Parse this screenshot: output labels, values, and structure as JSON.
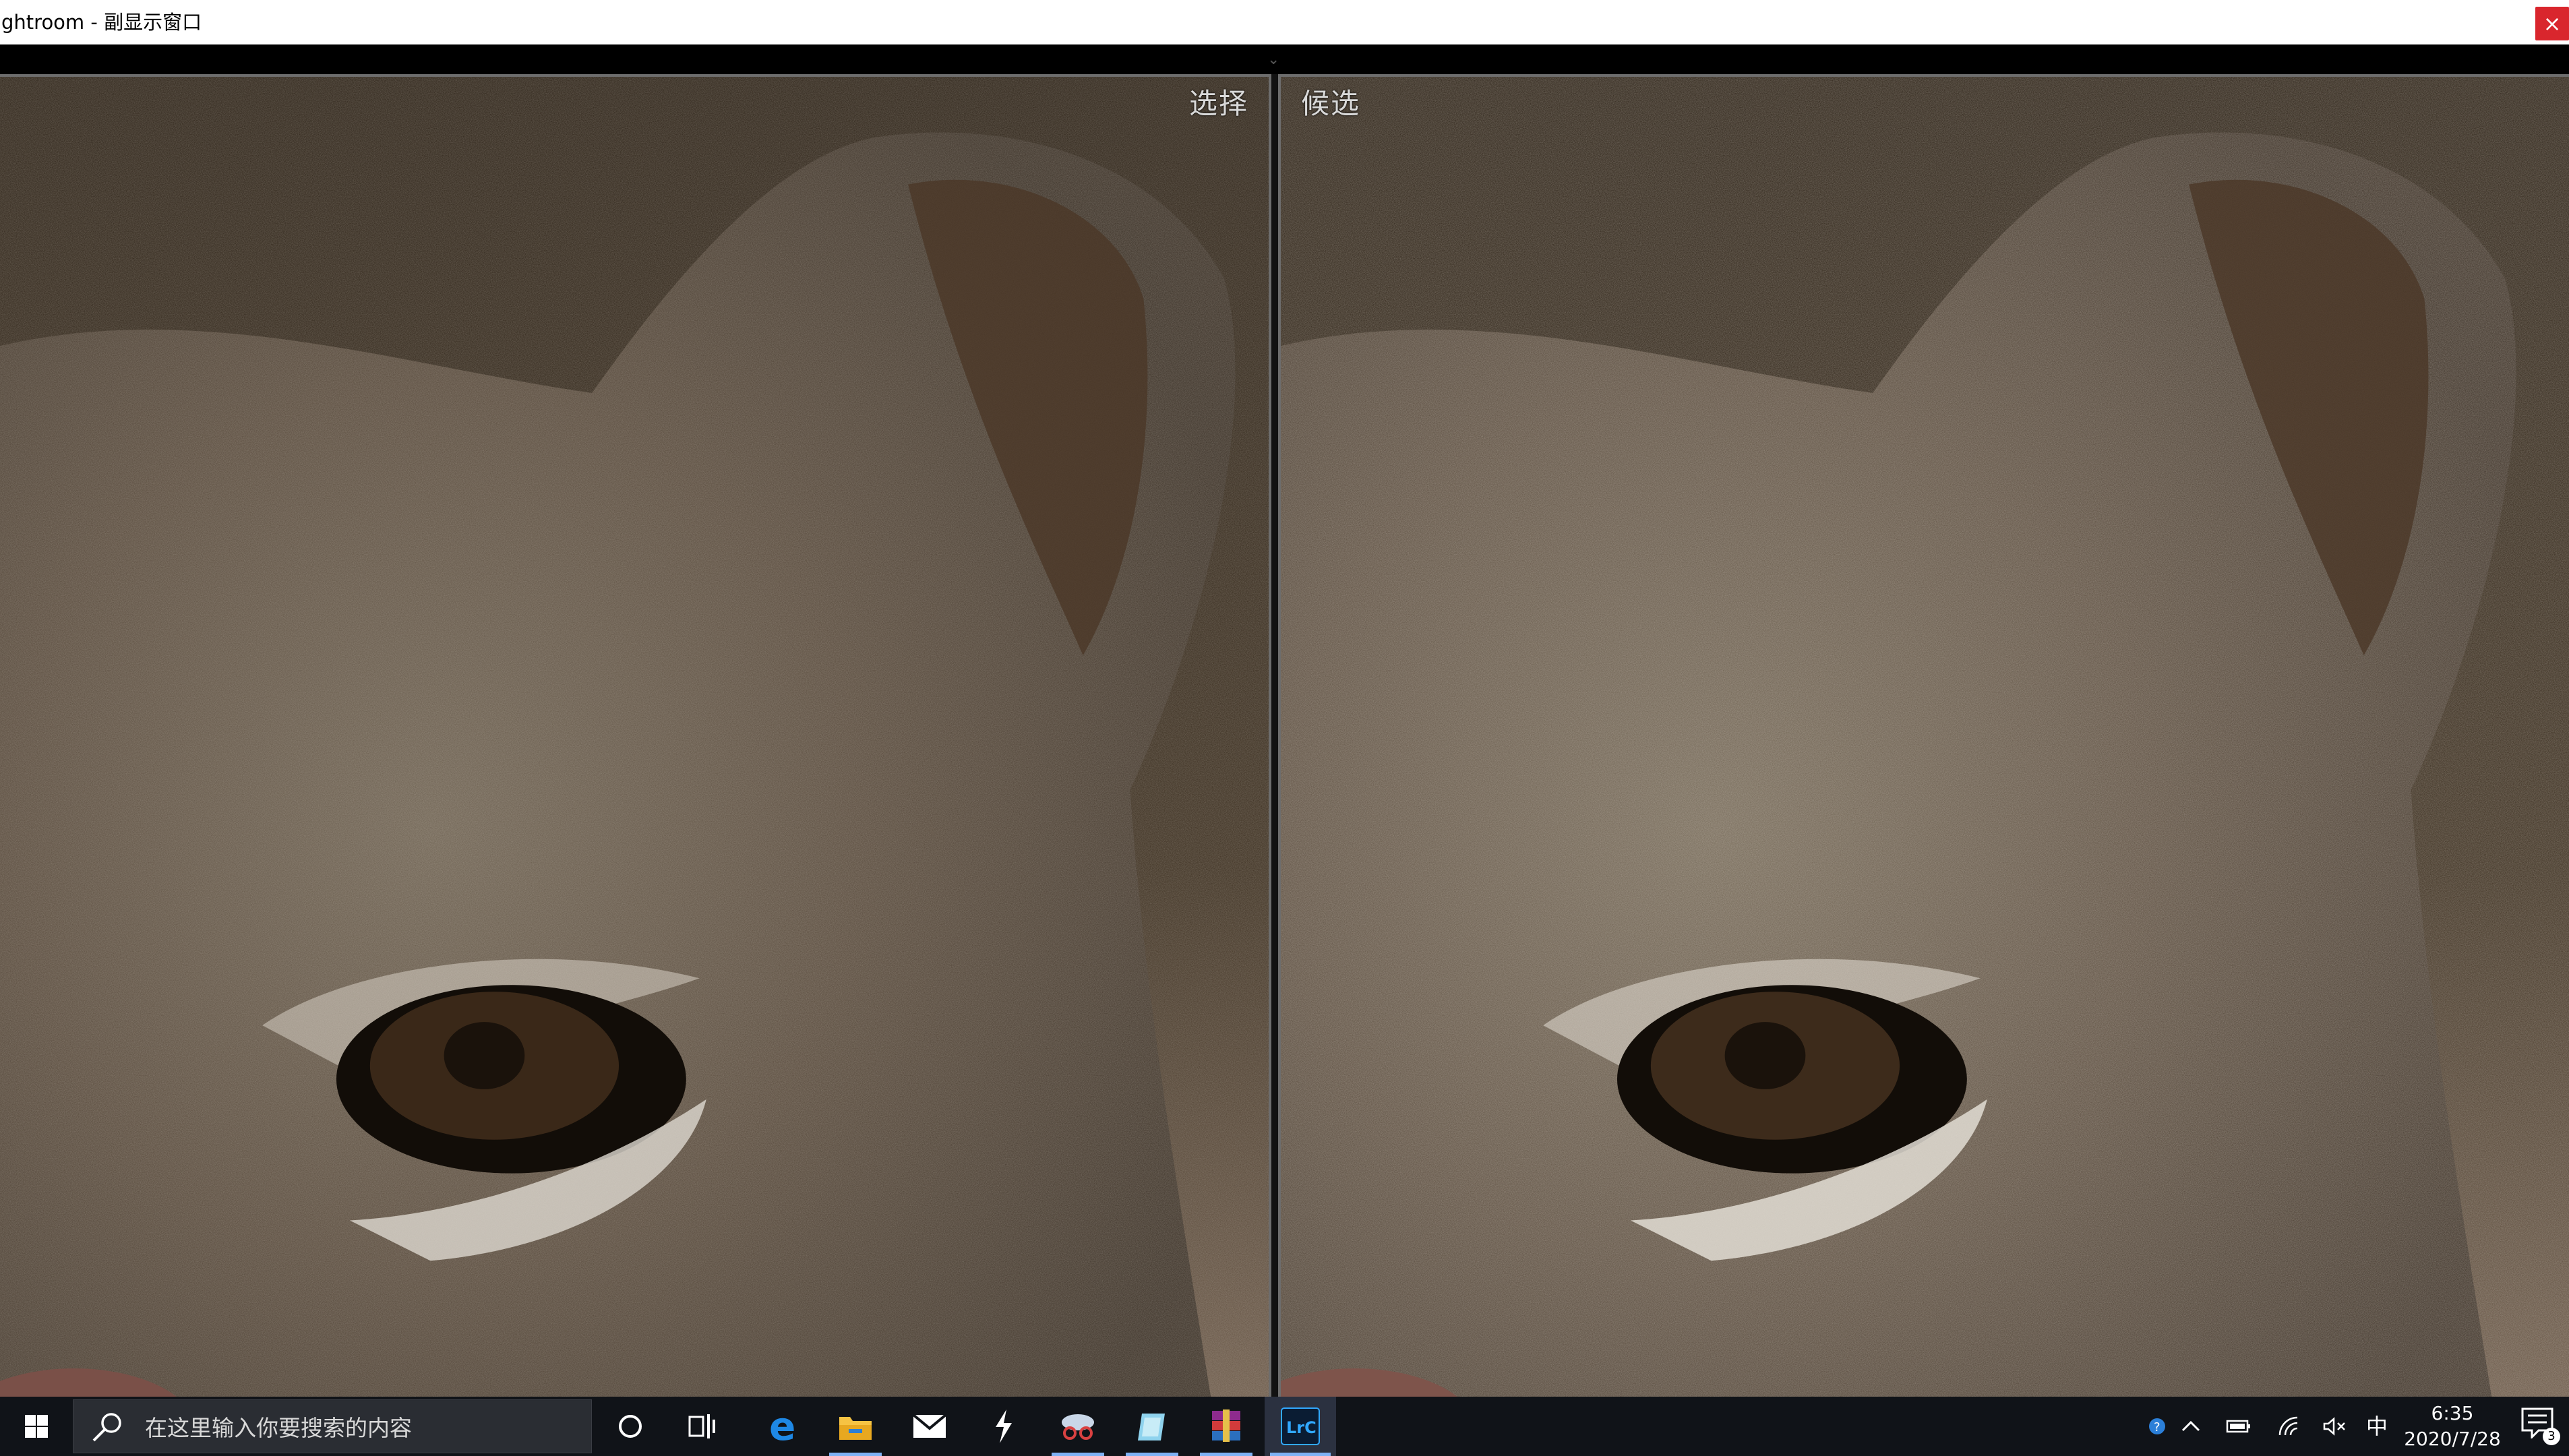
{
  "window": {
    "title": "ghtroom - 副显示窗口",
    "close_glyph": "×"
  },
  "compare": {
    "left_label": "选择",
    "right_label": "候选"
  },
  "taskbar": {
    "search_placeholder": "在这里输入你要搜索的内容",
    "pinned": [
      "cortana-icon",
      "task-view-icon",
      "edge-icon",
      "file-explorer-icon",
      "mail-icon",
      "app-lightning-icon",
      "snipping-tool-icon",
      "app-book-icon",
      "winrar-icon",
      "lightroom-classic-icon"
    ],
    "lightroom_label": "LrC",
    "ime_label": "中",
    "time": "6:35",
    "date": "2020/7/28",
    "notification_count": "3",
    "accent": "#7eb2f5"
  }
}
